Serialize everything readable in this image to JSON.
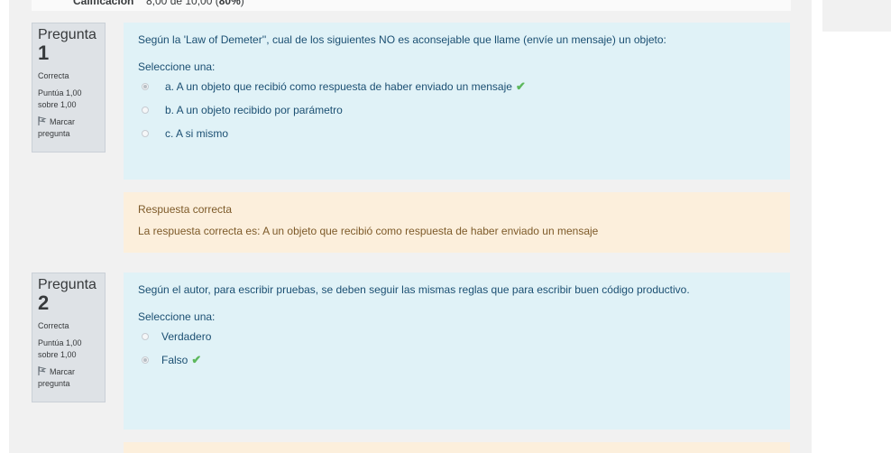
{
  "summary": {
    "label": "Calificación",
    "value_prefix": "8,00 de 10,00 (",
    "value_bold": "80%",
    "value_suffix": ")"
  },
  "questions": [
    {
      "label": "Pregunta",
      "number": "1",
      "state": "Correcta",
      "grade": "Puntúa 1,00 sobre 1,00",
      "flag_label": "Marcar pregunta",
      "text": "Según la 'Law of Demeter'', cual de los siguientes NO es aconsejable que llame (envíe un mensaje) un objeto:",
      "prompt": "Seleccione una:",
      "answers": [
        {
          "text": "a. A un objeto que recibió como respuesta de haber enviado un mensaje",
          "checked": true,
          "correct": true
        },
        {
          "text": "b. A un objeto recibido por parámetro",
          "checked": false,
          "correct": false
        },
        {
          "text": "c. A si mismo",
          "checked": false,
          "correct": false
        }
      ],
      "feedback": {
        "title": "Respuesta correcta",
        "text": "La respuesta correcta es: A un objeto que recibió como respuesta de haber enviado un mensaje"
      }
    },
    {
      "label": "Pregunta",
      "number": "2",
      "state": "Correcta",
      "grade": "Puntúa 1,00 sobre 1,00",
      "flag_label": "Marcar pregunta",
      "text": "Según el autor, para escribir pruebas, se deben seguir las mismas reglas que para escribir buen código productivo.",
      "prompt": "Seleccione una:",
      "answers": [
        {
          "text": "Verdadero",
          "checked": false,
          "correct": false
        },
        {
          "text": "Falso",
          "checked": true,
          "correct": true
        }
      ]
    }
  ],
  "icons": {
    "flag": "flag-icon",
    "check": "check-icon"
  },
  "colors": {
    "content_bg": "#e0f2f7",
    "feedback_bg": "#fcefdc",
    "info_bg": "#dee2e6",
    "check": "#5cb85c"
  }
}
